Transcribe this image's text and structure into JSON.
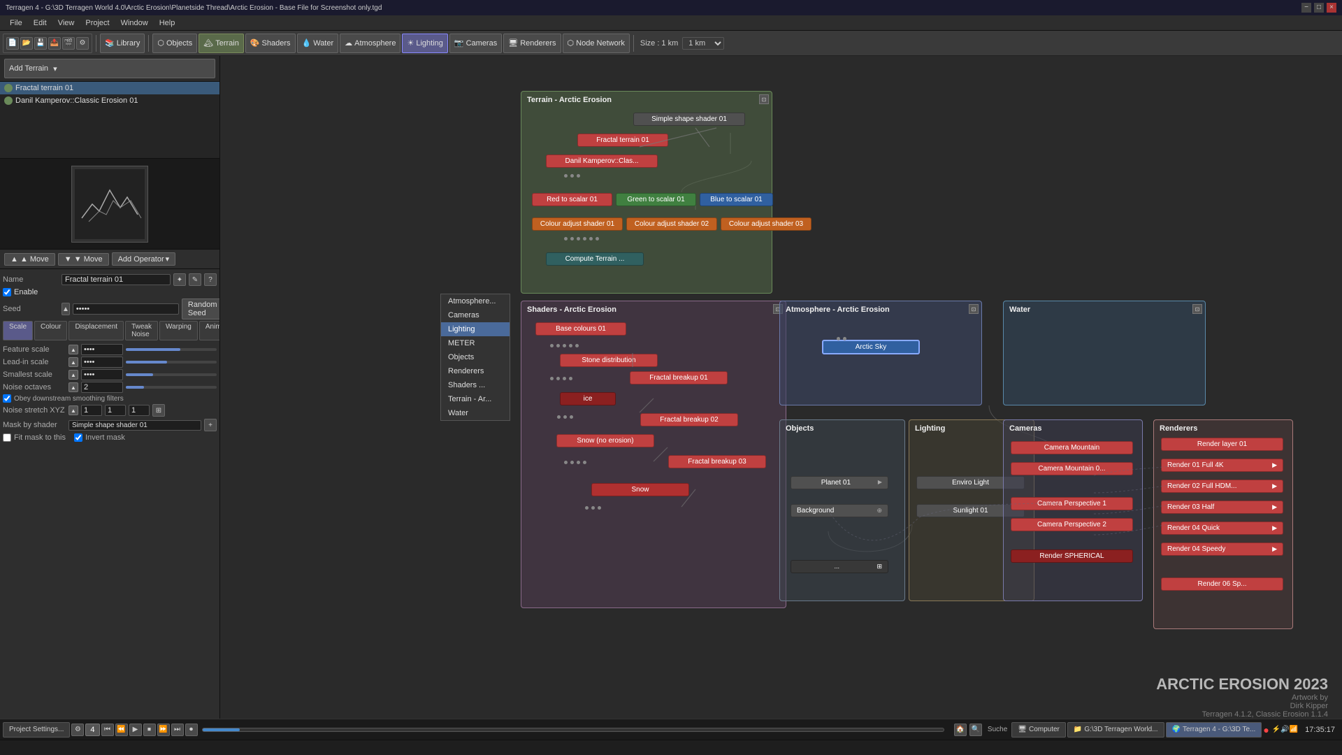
{
  "titlebar": {
    "title": "Terragen 4 - G:\\3D Terragen World 4.0\\Arctic Erosion\\Planetside Thread\\Arctic Erosion - Base File for Screenshot only.tgd",
    "controls": [
      "−",
      "□",
      "×"
    ]
  },
  "menubar": {
    "items": [
      "File",
      "Edit",
      "View",
      "Project",
      "Window",
      "Help"
    ]
  },
  "toolbar": {
    "library_label": "Library",
    "objects_label": "Objects",
    "terrain_label": "Terrain",
    "shaders_label": "Shaders",
    "water_label": "Water",
    "atmosphere_label": "Atmosphere",
    "lighting_label": "Lighting",
    "cameras_label": "Cameras",
    "renderers_label": "Renderers",
    "node_network_label": "Node Network",
    "size_label": "Size : 1 km"
  },
  "left_panel": {
    "add_terrain_label": "Add Terrain",
    "terrain_items": [
      {
        "name": "Fractal terrain 01",
        "active": true
      },
      {
        "name": "Danil Kamperov::Classic Erosion 01",
        "active": true
      }
    ],
    "move_up_label": "▲ Move",
    "move_down_label": "▼ Move",
    "add_operator_label": "Add Operator",
    "properties": {
      "name_label": "Name",
      "name_value": "Fractal terrain 01",
      "enable_label": "Enable",
      "seed_label": "Seed",
      "seed_value": "•••••",
      "random_seed_label": "Random Seed",
      "tabs": [
        "Scale",
        "Colour",
        "Displacement",
        "Tweak Noise",
        "Warping",
        "Animation"
      ],
      "feature_scale_label": "Feature scale",
      "feature_scale_value": "••••",
      "lead_in_scale_label": "Lead-in scale",
      "lead_in_scale_value": "••••",
      "smallest_scale_label": "Smallest scale",
      "smallest_scale_value": "••••",
      "noise_octaves_label": "Noise octaves",
      "noise_octaves_value": "2",
      "obey_smooth_label": "Obey downstream smoothing filters",
      "noise_stretch_label": "Noise stretch XYZ",
      "noise_x": "1",
      "noise_y": "1",
      "noise_z": "1",
      "mask_label": "Mask by shader",
      "mask_value": "Simple shape shader 01",
      "fit_mask_label": "Fit mask to this",
      "invert_mask_label": "Invert mask"
    }
  },
  "context_menu": {
    "items": [
      {
        "label": "Atmosphere...",
        "active": false
      },
      {
        "label": "Cameras",
        "active": false
      },
      {
        "label": "Lighting",
        "active": true
      },
      {
        "label": "METER",
        "active": false
      },
      {
        "label": "Objects",
        "active": false
      },
      {
        "label": "Renderers",
        "active": false
      },
      {
        "label": "Shaders ...",
        "active": false
      },
      {
        "label": "Terrain - Ar...",
        "active": false
      },
      {
        "label": "Water",
        "active": false
      }
    ]
  },
  "node_groups": {
    "terrain": {
      "title": "Terrain - Arctic Erosion",
      "nodes": [
        {
          "id": "simple_shape",
          "label": "Simple shape shader 01",
          "type": "gray"
        },
        {
          "id": "fractal_terrain",
          "label": "Fractal terrain 01",
          "type": "red"
        },
        {
          "id": "danil_class",
          "label": "Danil Kamperov::Class...",
          "type": "red"
        },
        {
          "id": "red_scalar",
          "label": "Red to scalar 01",
          "type": "red"
        },
        {
          "id": "green_scalar",
          "label": "Green to scalar 01",
          "type": "green"
        },
        {
          "id": "blue_scalar",
          "label": "Blue to scalar 01",
          "type": "blue"
        },
        {
          "id": "colour_adj1",
          "label": "Colour adjust shader 01",
          "type": "orange"
        },
        {
          "id": "colour_adj2",
          "label": "Colour adjust shader 02",
          "type": "orange"
        },
        {
          "id": "colour_adj3",
          "label": "Colour adjust shader 03",
          "type": "orange"
        },
        {
          "id": "compute_terrain",
          "label": "Compute Terrain ...",
          "type": "teal"
        }
      ]
    },
    "shaders": {
      "title": "Shaders - Arctic Erosion",
      "nodes": [
        {
          "id": "base_colours",
          "label": "Base colours 01",
          "type": "red"
        },
        {
          "id": "stone_dist",
          "label": "Stone distribution",
          "type": "red"
        },
        {
          "id": "fractal_break1",
          "label": "Fractal breakup 01",
          "type": "red"
        },
        {
          "id": "ice",
          "label": "ice",
          "type": "dark-red"
        },
        {
          "id": "fractal_break2",
          "label": "Fractal breakup 02",
          "type": "red"
        },
        {
          "id": "snow_no_erosion",
          "label": "Snow (no erosion)",
          "type": "red"
        },
        {
          "id": "fractal_break3",
          "label": "Fractal breakup 03",
          "type": "red"
        },
        {
          "id": "snow",
          "label": "Snow",
          "type": "red"
        }
      ]
    },
    "atmosphere": {
      "title": "Atmosphere - Arctic Erosion",
      "nodes": [
        {
          "id": "arctic_sky",
          "label": "Arctic Sky",
          "type": "blue"
        }
      ]
    },
    "water": {
      "title": "Water",
      "nodes": []
    },
    "objects": {
      "title": "Objects",
      "nodes": [
        {
          "id": "planet_01",
          "label": "Planet 01",
          "type": "gray"
        },
        {
          "id": "background",
          "label": "Background",
          "type": "gray"
        }
      ]
    },
    "lighting": {
      "title": "Lighting",
      "nodes": [
        {
          "id": "enviro_light",
          "label": "Enviro Light",
          "type": "gray"
        },
        {
          "id": "sunlight_01",
          "label": "Sunlight 01",
          "type": "gray"
        }
      ]
    },
    "cameras": {
      "title": "Cameras",
      "nodes": [
        {
          "id": "cam_mountain",
          "label": "Camera Mountain",
          "type": "red"
        },
        {
          "id": "cam_mountain02",
          "label": "Camera Mountain 0...",
          "type": "red"
        },
        {
          "id": "cam_perspective1",
          "label": "Camera Perspective 1",
          "type": "red"
        },
        {
          "id": "cam_perspective2",
          "label": "Camera Perspective 2",
          "type": "red"
        },
        {
          "id": "render_spherical",
          "label": "Render SPHERICAL",
          "type": "dark-red"
        }
      ]
    },
    "renderers": {
      "title": "Renderers",
      "nodes": [
        {
          "id": "render_layer",
          "label": "Render layer 01",
          "type": "red"
        },
        {
          "id": "render_full_4k",
          "label": "Render 01 Full 4K",
          "type": "red"
        },
        {
          "id": "render_full_hdm",
          "label": "Render 02 Full HDM...",
          "type": "red"
        },
        {
          "id": "render_half",
          "label": "Render 03 Half",
          "type": "red"
        },
        {
          "id": "render_quick",
          "label": "Render 04 Quick",
          "type": "red"
        },
        {
          "id": "render_speedy",
          "label": "Render 04 Speedy",
          "type": "red"
        },
        {
          "id": "render_06",
          "label": "Render 06 Sp...",
          "type": "red"
        }
      ]
    }
  },
  "watermark": {
    "title": "ARCTIC EROSION 2023",
    "line1": "Artwork by",
    "line2": "Dirk Kipper",
    "line3": "Terragen 4.1.2, Classic Erosion 1.1.4"
  },
  "statusbar": {
    "project_settings": "Project Settings...",
    "threads": "4",
    "time": "17:35:17",
    "record_dot": "●"
  },
  "taskbar": {
    "items": [
      {
        "label": "Computer",
        "icon": "🖥"
      },
      {
        "label": "G:\\3D Terragen World...",
        "icon": "📁"
      },
      {
        "label": "Terragen 4 - G:\\3D Te...",
        "icon": "🌍",
        "active": true
      }
    ]
  }
}
